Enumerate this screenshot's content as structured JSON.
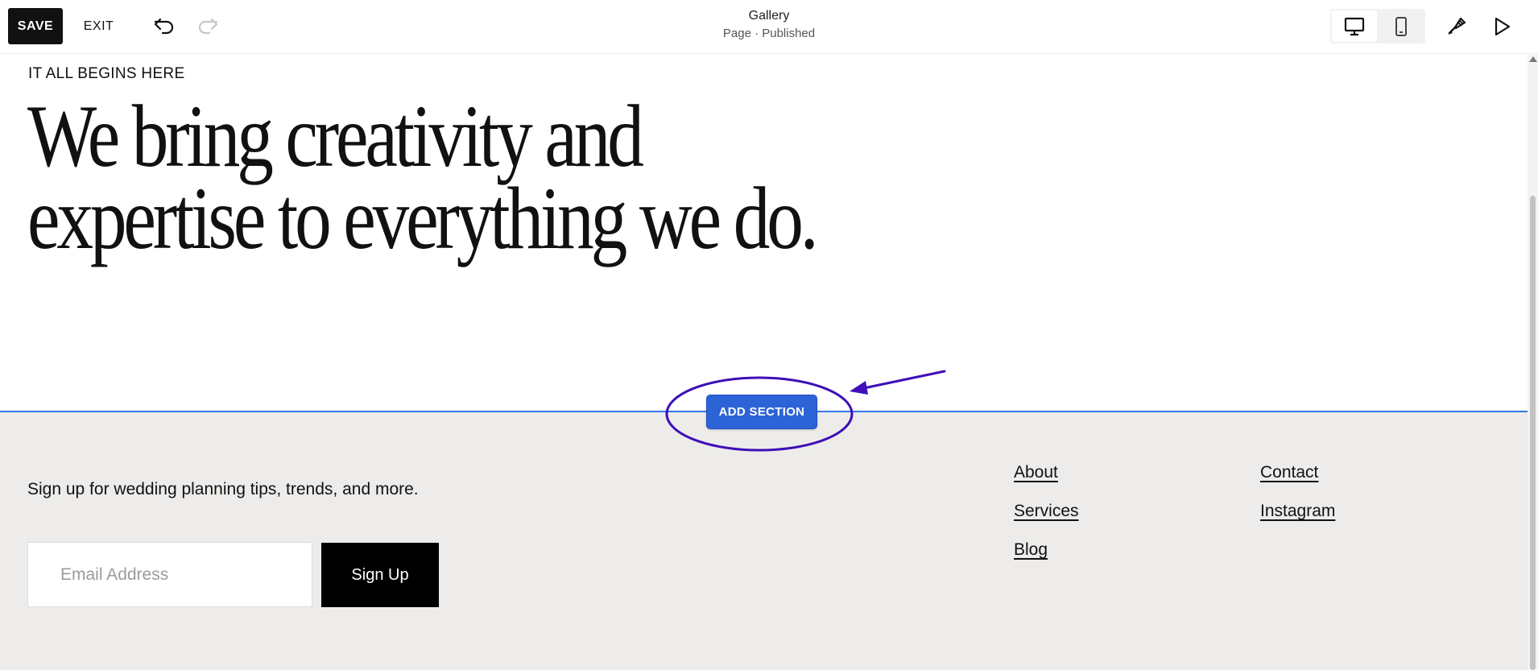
{
  "toolbar": {
    "save_label": "SAVE",
    "exit_label": "EXIT",
    "icons": [
      "undo-icon",
      "redo-icon",
      "desktop-icon",
      "mobile-icon",
      "paintbrush-icon",
      "play-icon"
    ]
  },
  "page": {
    "title": "Gallery",
    "status": "Page · Published"
  },
  "hero": {
    "eyebrow": "IT ALL BEGINS HERE",
    "headline": "We bring creativity and expertise to everything we do."
  },
  "editor": {
    "add_section_label": "ADD SECTION",
    "accent_color": "#2c63d6",
    "annotation_color": "#3f0fb7"
  },
  "footer": {
    "signup_text": "Sign up for wedding planning tips, trends, and more.",
    "email_placeholder": "Email Address",
    "signup_button": "Sign Up",
    "links_col1": [
      "About",
      "Services",
      "Blog"
    ],
    "links_col2": [
      "Contact",
      "Instagram"
    ],
    "background": "#edecea"
  }
}
